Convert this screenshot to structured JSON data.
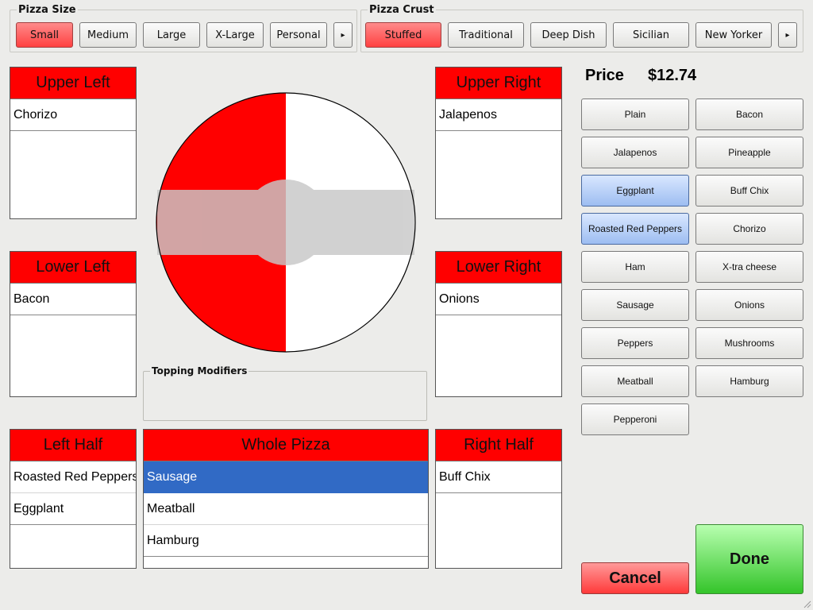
{
  "size": {
    "title": "Pizza Size",
    "options": [
      "Small",
      "Medium",
      "Large",
      "X-Large",
      "Personal"
    ],
    "selected": "Small"
  },
  "crust": {
    "title": "Pizza Crust",
    "options": [
      "Stuffed",
      "Traditional",
      "Deep Dish",
      "Sicilian",
      "New Yorker"
    ],
    "selected": "Stuffed"
  },
  "quadrants": {
    "upper_left": {
      "title": "Upper Left",
      "items": [
        "Chorizo"
      ]
    },
    "upper_right": {
      "title": "Upper Right",
      "items": [
        "Jalapenos"
      ]
    },
    "lower_left": {
      "title": "Lower Left",
      "items": [
        "Bacon"
      ]
    },
    "lower_right": {
      "title": "Lower Right",
      "items": [
        "Onions"
      ]
    },
    "left_half": {
      "title": "Left Half",
      "items": [
        "Roasted Red Peppers",
        "Eggplant"
      ]
    },
    "whole": {
      "title": "Whole Pizza",
      "items": [
        "Sausage",
        "Meatball",
        "Hamburg"
      ],
      "selected": "Sausage"
    },
    "right_half": {
      "title": "Right Half",
      "items": [
        "Buff Chix"
      ]
    }
  },
  "modifiers": {
    "title": "Topping Modifiers"
  },
  "price": {
    "label": "Price",
    "value": "$12.74"
  },
  "toppings": [
    [
      "Plain",
      "Bacon"
    ],
    [
      "Jalapenos",
      "Pineapple"
    ],
    [
      "Eggplant",
      "Buff Chix"
    ],
    [
      "Roasted Red Peppers",
      "Chorizo"
    ],
    [
      "Ham",
      "X-tra cheese"
    ],
    [
      "Sausage",
      "Onions"
    ],
    [
      "Peppers",
      "Mushrooms"
    ],
    [
      "Meatball",
      "Hamburg"
    ],
    [
      "Pepperoni"
    ]
  ],
  "highlighted_toppings": [
    "Eggplant",
    "Roasted Red Peppers"
  ],
  "actions": {
    "done": "Done",
    "cancel": "Cancel"
  },
  "colors": {
    "accent_red": "#ff0000",
    "selection_blue": "#316ac5",
    "done_green": "#34c42a"
  },
  "icons": {
    "scroll_right": "▸"
  }
}
